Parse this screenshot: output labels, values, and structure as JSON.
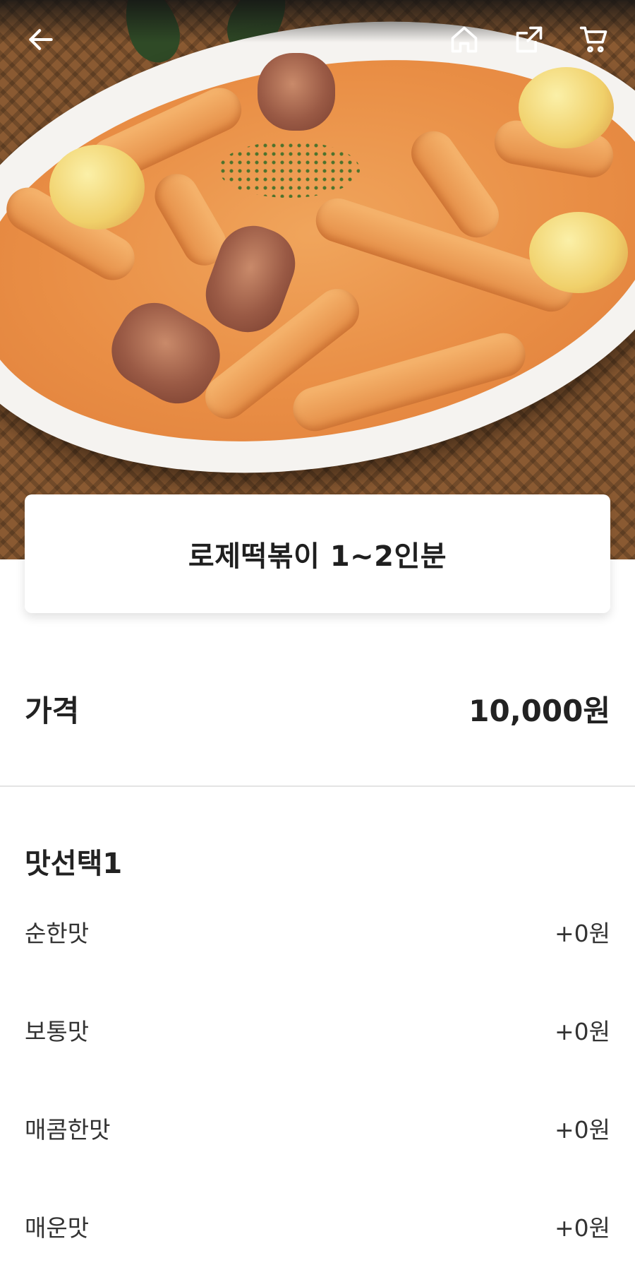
{
  "header": {
    "icons": [
      "back-arrow-icon",
      "home-icon",
      "share-icon",
      "cart-icon"
    ]
  },
  "product": {
    "title": "로제떡볶이 1~2인분",
    "price_label": "가격",
    "price_value": "10,000원"
  },
  "option_group": {
    "title": "맛선택1",
    "options": [
      {
        "label": "순한맛",
        "price": "+0원"
      },
      {
        "label": "보통맛",
        "price": "+0원"
      },
      {
        "label": "매콤한맛",
        "price": "+0원"
      },
      {
        "label": "매운맛",
        "price": "+0원"
      }
    ]
  },
  "colors": {
    "text": "#222222",
    "divider": "#e4e4e4",
    "sauce": "#e98e45"
  }
}
